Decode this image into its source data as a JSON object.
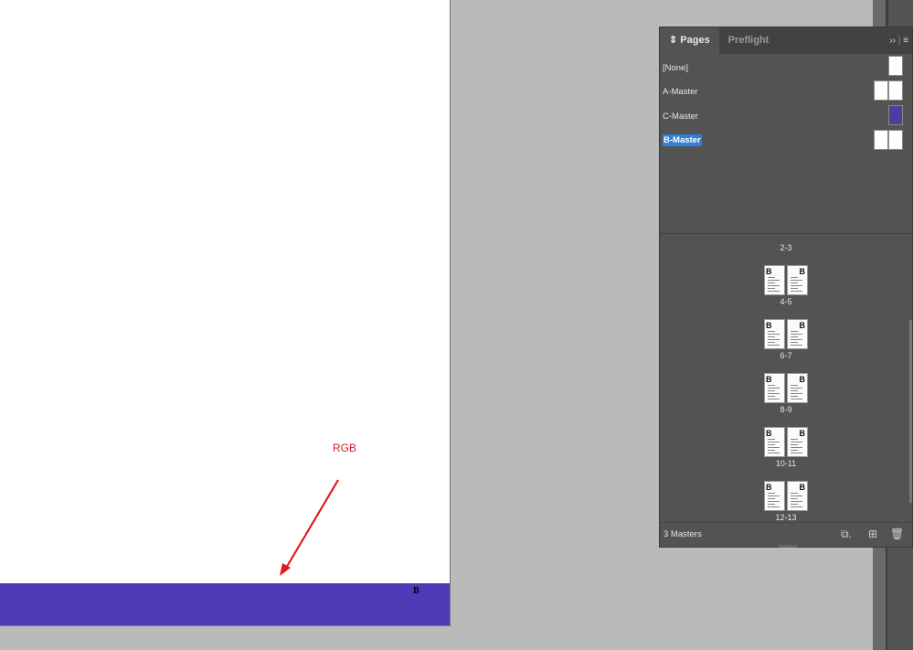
{
  "colors": {
    "band": "#4f3bb8",
    "annotation": "#d81e1e",
    "selection": "#2f7fd8"
  },
  "document": {
    "annotation_label": "RGB",
    "band_letter": "B"
  },
  "panel": {
    "tabs": [
      {
        "label": "Pages",
        "active": true
      },
      {
        "label": "Preflight",
        "active": false
      }
    ],
    "collapse_icon": "double-chevron-right-icon",
    "menu_icon": "hamburger-menu-icon",
    "masters": [
      {
        "label": "[None]",
        "pages": 1,
        "selected": false
      },
      {
        "label": "A-Master",
        "pages": 2,
        "selected": false
      },
      {
        "label": "C-Master",
        "pages": 1,
        "selected": false,
        "color": "#4a3f9a"
      },
      {
        "label": "B-Master",
        "pages": 2,
        "selected": true
      }
    ],
    "spreads": [
      "2-3",
      "4-5",
      "6-7",
      "8-9",
      "10-11",
      "12-13"
    ],
    "footer": {
      "label": "3 Masters",
      "icons": [
        "edit-page-size-icon",
        "new-page-icon",
        "trash-icon"
      ]
    }
  }
}
